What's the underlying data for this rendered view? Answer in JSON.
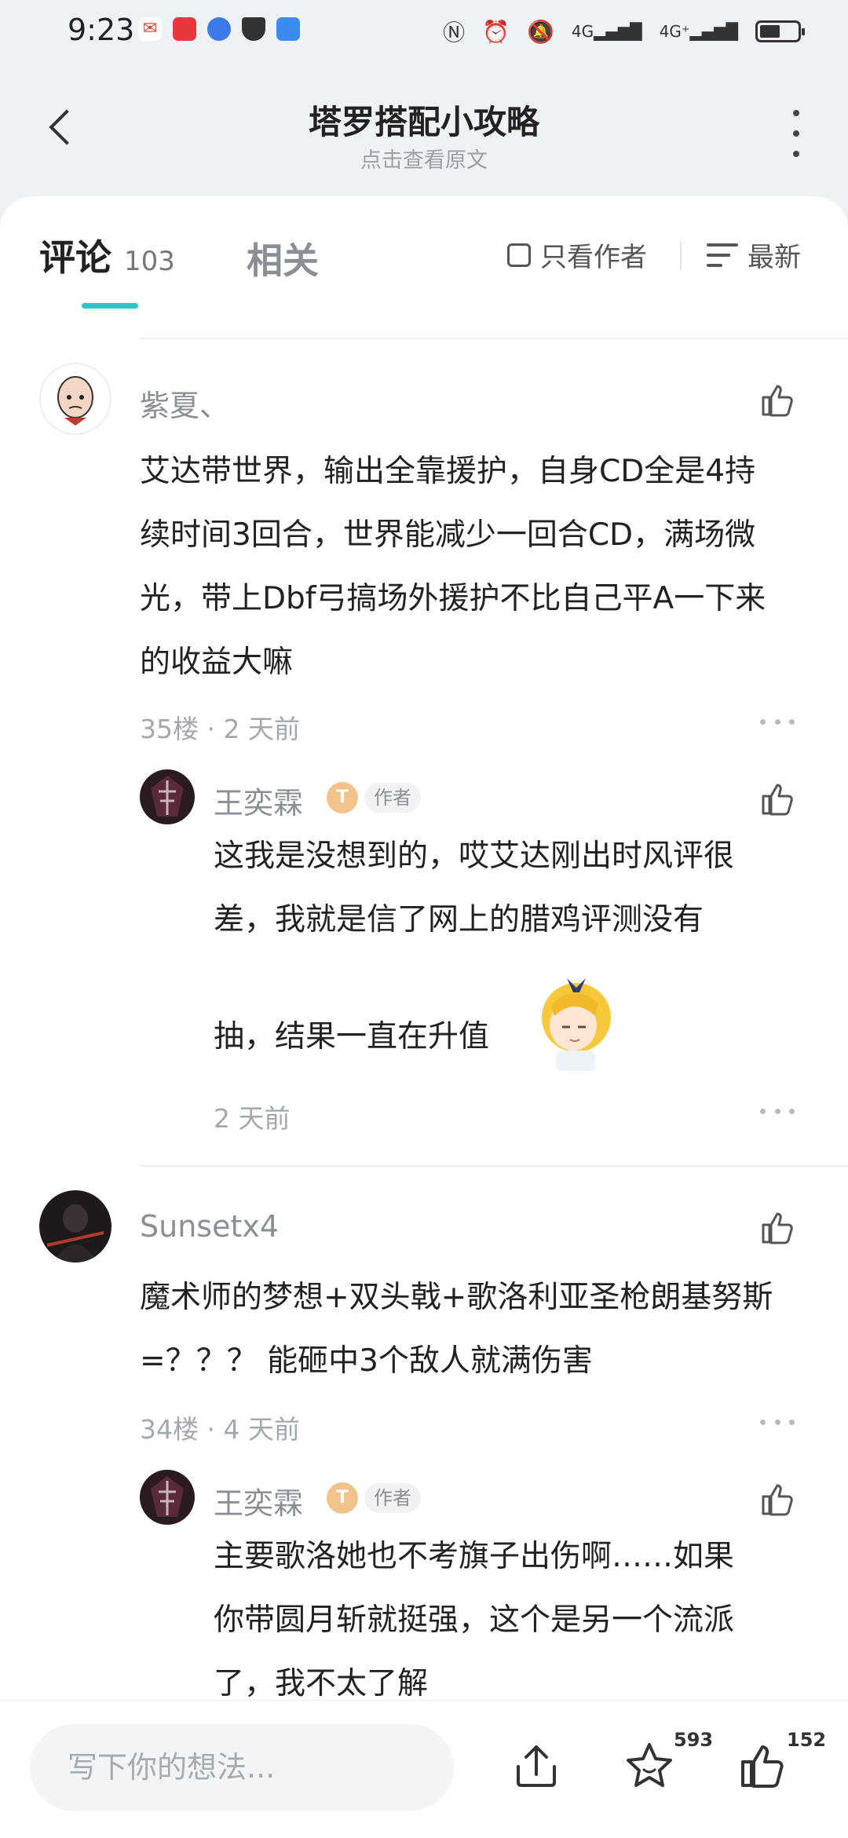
{
  "status_bar": {
    "time": "9:23",
    "network_1": "4G",
    "network_2": "4G⁺",
    "icons_left": [
      "mail-icon",
      "red-app-icon",
      "globe-icon",
      "shield-icon",
      "cloud-icon"
    ],
    "icons_right": [
      "nfc-icon",
      "alarm-icon",
      "mute-icon",
      "signal-icon",
      "signal-icon",
      "battery-icon"
    ],
    "battery_level": 0.55
  },
  "header": {
    "title": "塔罗搭配小攻略",
    "subtitle": "点击查看原文"
  },
  "tabs": {
    "comments_label": "评论",
    "comments_count": "103",
    "related_label": "相关",
    "only_author_label": "只看作者",
    "sort_label": "最新",
    "accent": "#2ec4c8"
  },
  "comments": [
    {
      "user": "紫夏、",
      "text": [
        "艾达带世界，输出全靠援护，自身CD全是4持",
        "续时间3回合，世界能减少一回合CD，满场微",
        "光，带上Dbf弓搞场外援护不比自己平A一下来",
        "的收益大嘛"
      ],
      "meta": "35楼 · 2 天前",
      "reply": {
        "user": "王奕霖",
        "level_badge": "T",
        "author_badge": "作者",
        "text": [
          "这我是没想到的，哎艾达刚出时风评很",
          "差，我就是信了网上的腊鸡评测没有"
        ],
        "text_after_sticker": "抽，结果一直在升值",
        "meta": "2 天前"
      }
    },
    {
      "user": "Sunsetx4",
      "text": [
        "魔术师的梦想+双头戟+歌洛利亚圣枪朗基努斯",
        "=？？？  能砸中3个敌人就满伤害"
      ],
      "meta": "34楼 · 4 天前",
      "reply": {
        "user": "王奕霖",
        "level_badge": "T",
        "author_badge": "作者",
        "text": [
          "主要歌洛她也不考旗子出伤啊……如果",
          "你带圆月斩就挺强，这个是另一个流派",
          "了，我不太了解"
        ]
      }
    }
  ],
  "bottom_bar": {
    "input_placeholder": "写下你的想法...",
    "favorite_count": "593",
    "like_count": "152"
  }
}
